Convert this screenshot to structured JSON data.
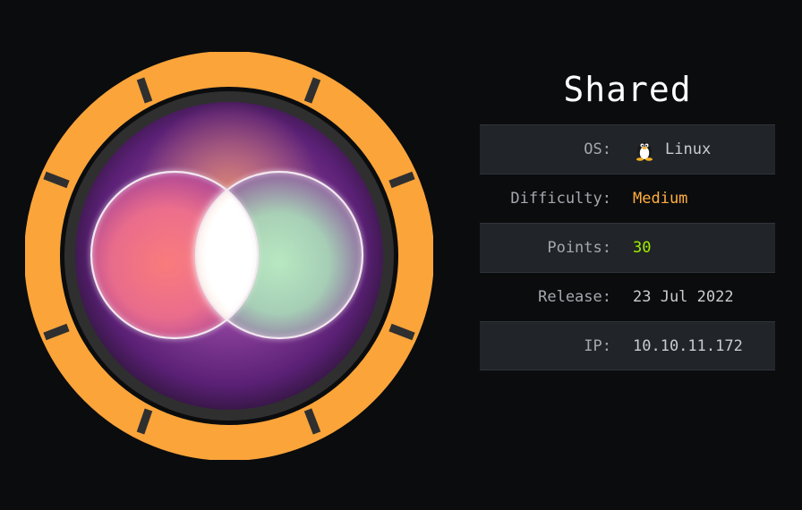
{
  "machine": {
    "name": "Shared"
  },
  "info": {
    "os_label": "OS:",
    "os_value": "Linux",
    "os_icon": "tux-penguin-icon",
    "difficulty_label": "Difficulty:",
    "difficulty_value": "Medium",
    "points_label": "Points:",
    "points_value": "30",
    "release_label": "Release:",
    "release_value": "23 Jul 2022",
    "ip_label": "IP:",
    "ip_value": "10.10.11.172"
  },
  "colors": {
    "background": "#0b0c0e",
    "ring": "#faa43a",
    "ring_gap": "#2f2f2f",
    "difficulty": "#ffaf3f",
    "points": "#9fef00",
    "row_shade": "#212428"
  }
}
